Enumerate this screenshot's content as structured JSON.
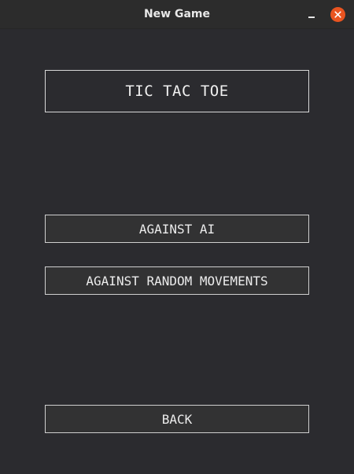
{
  "window": {
    "title": "New Game"
  },
  "main": {
    "game_title": "TIC TAC TOE",
    "buttons": {
      "against_ai": "AGAINST AI",
      "against_random": "AGAINST RANDOM MOVEMENTS",
      "back": "BACK"
    }
  },
  "icons": {
    "minimize": "minimize-icon",
    "close": "close-icon"
  },
  "colors": {
    "background": "#2b2b2f",
    "titlebar": "#2c2c2c",
    "close_button": "#e95420",
    "button_fill": "#323233",
    "border": "#d8d8d8",
    "text": "#ececec"
  }
}
